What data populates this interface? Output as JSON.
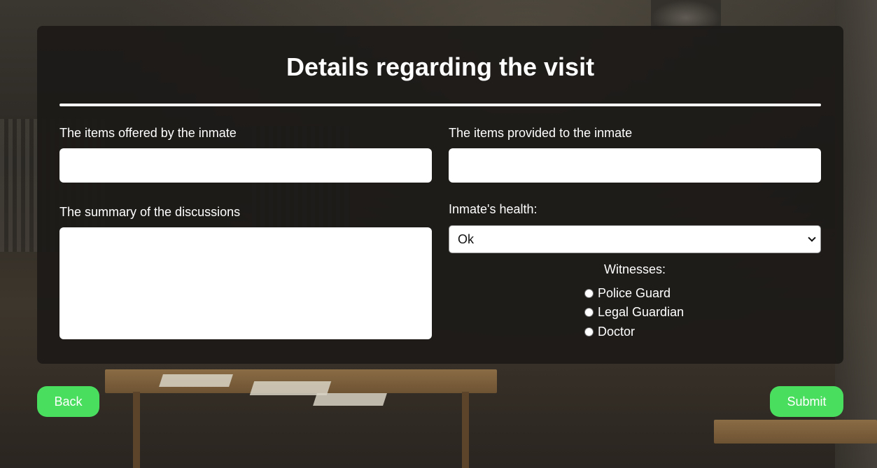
{
  "page": {
    "title": "Details regarding the visit"
  },
  "form": {
    "items_offered": {
      "label": "The items offered by the inmate",
      "value": ""
    },
    "items_provided": {
      "label": "The items provided to the inmate",
      "value": ""
    },
    "summary": {
      "label": "The summary of the discussions",
      "value": ""
    },
    "health": {
      "label": "Inmate's health:",
      "selected": "Ok"
    },
    "witnesses": {
      "label": "Witnesses:",
      "options": [
        {
          "label": "Police Guard",
          "checked": false
        },
        {
          "label": "Legal Guardian",
          "checked": false
        },
        {
          "label": "Doctor",
          "checked": false
        }
      ]
    }
  },
  "actions": {
    "back_label": "Back",
    "submit_label": "Submit"
  },
  "colors": {
    "button": "#4ade5f",
    "panel": "#1c1a18",
    "text": "#ffffff"
  }
}
